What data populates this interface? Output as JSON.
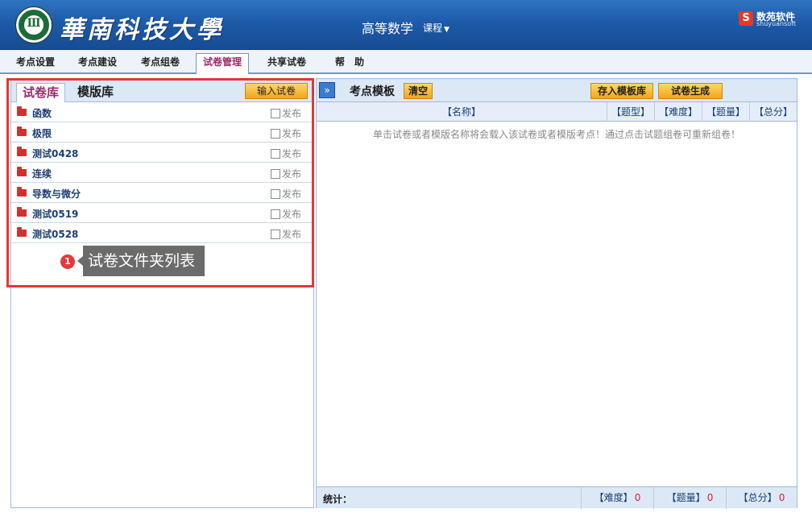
{
  "header": {
    "university": "華南科技大學",
    "course_title": "高等数学",
    "course_menu": "课程",
    "brand_cn": "数苑软件",
    "brand_en": "shuyuansoft"
  },
  "menu": [
    {
      "label": "考点设置"
    },
    {
      "label": "考点建设"
    },
    {
      "label": "考点组卷"
    },
    {
      "label": "试卷管理"
    },
    {
      "label": "共享试卷"
    },
    {
      "label": "帮　助"
    }
  ],
  "left": {
    "tab_active": "试卷库",
    "tab_other": "模版库",
    "import_button": "输入试卷",
    "publish_label": "发布",
    "folders": [
      {
        "name": "函数"
      },
      {
        "name": "极限"
      },
      {
        "name": "测试0428"
      },
      {
        "name": "连续"
      },
      {
        "name": "导数与微分"
      },
      {
        "name": "测试0519"
      },
      {
        "name": "测试0528"
      }
    ]
  },
  "annotation": {
    "badge": "1",
    "text": "试卷文件夹列表"
  },
  "right": {
    "expand_glyph": "»",
    "title": "考点模板",
    "clear_button": "清空",
    "save_template_button": "存入模板库",
    "generate_button": "试卷生成",
    "columns": [
      "【名称】",
      "【题型】",
      "【难度】",
      "【题量】",
      "【总分】"
    ],
    "hint": "单击试卷或者模版名称将会载入该试卷或者模版考点！通过点击试题组卷可重新组卷！",
    "stats_label": "统计：",
    "stats": [
      {
        "label": "【难度】",
        "value": "0"
      },
      {
        "label": "【题量】",
        "value": "0"
      },
      {
        "label": "【总分】",
        "value": "0"
      }
    ]
  },
  "colors": {
    "header_blue": "#1e5aa8",
    "active_tab": "#a0286a",
    "button_orange": "#f3a51b",
    "highlight_red": "#e0383a",
    "folder_red": "#d0312d"
  }
}
